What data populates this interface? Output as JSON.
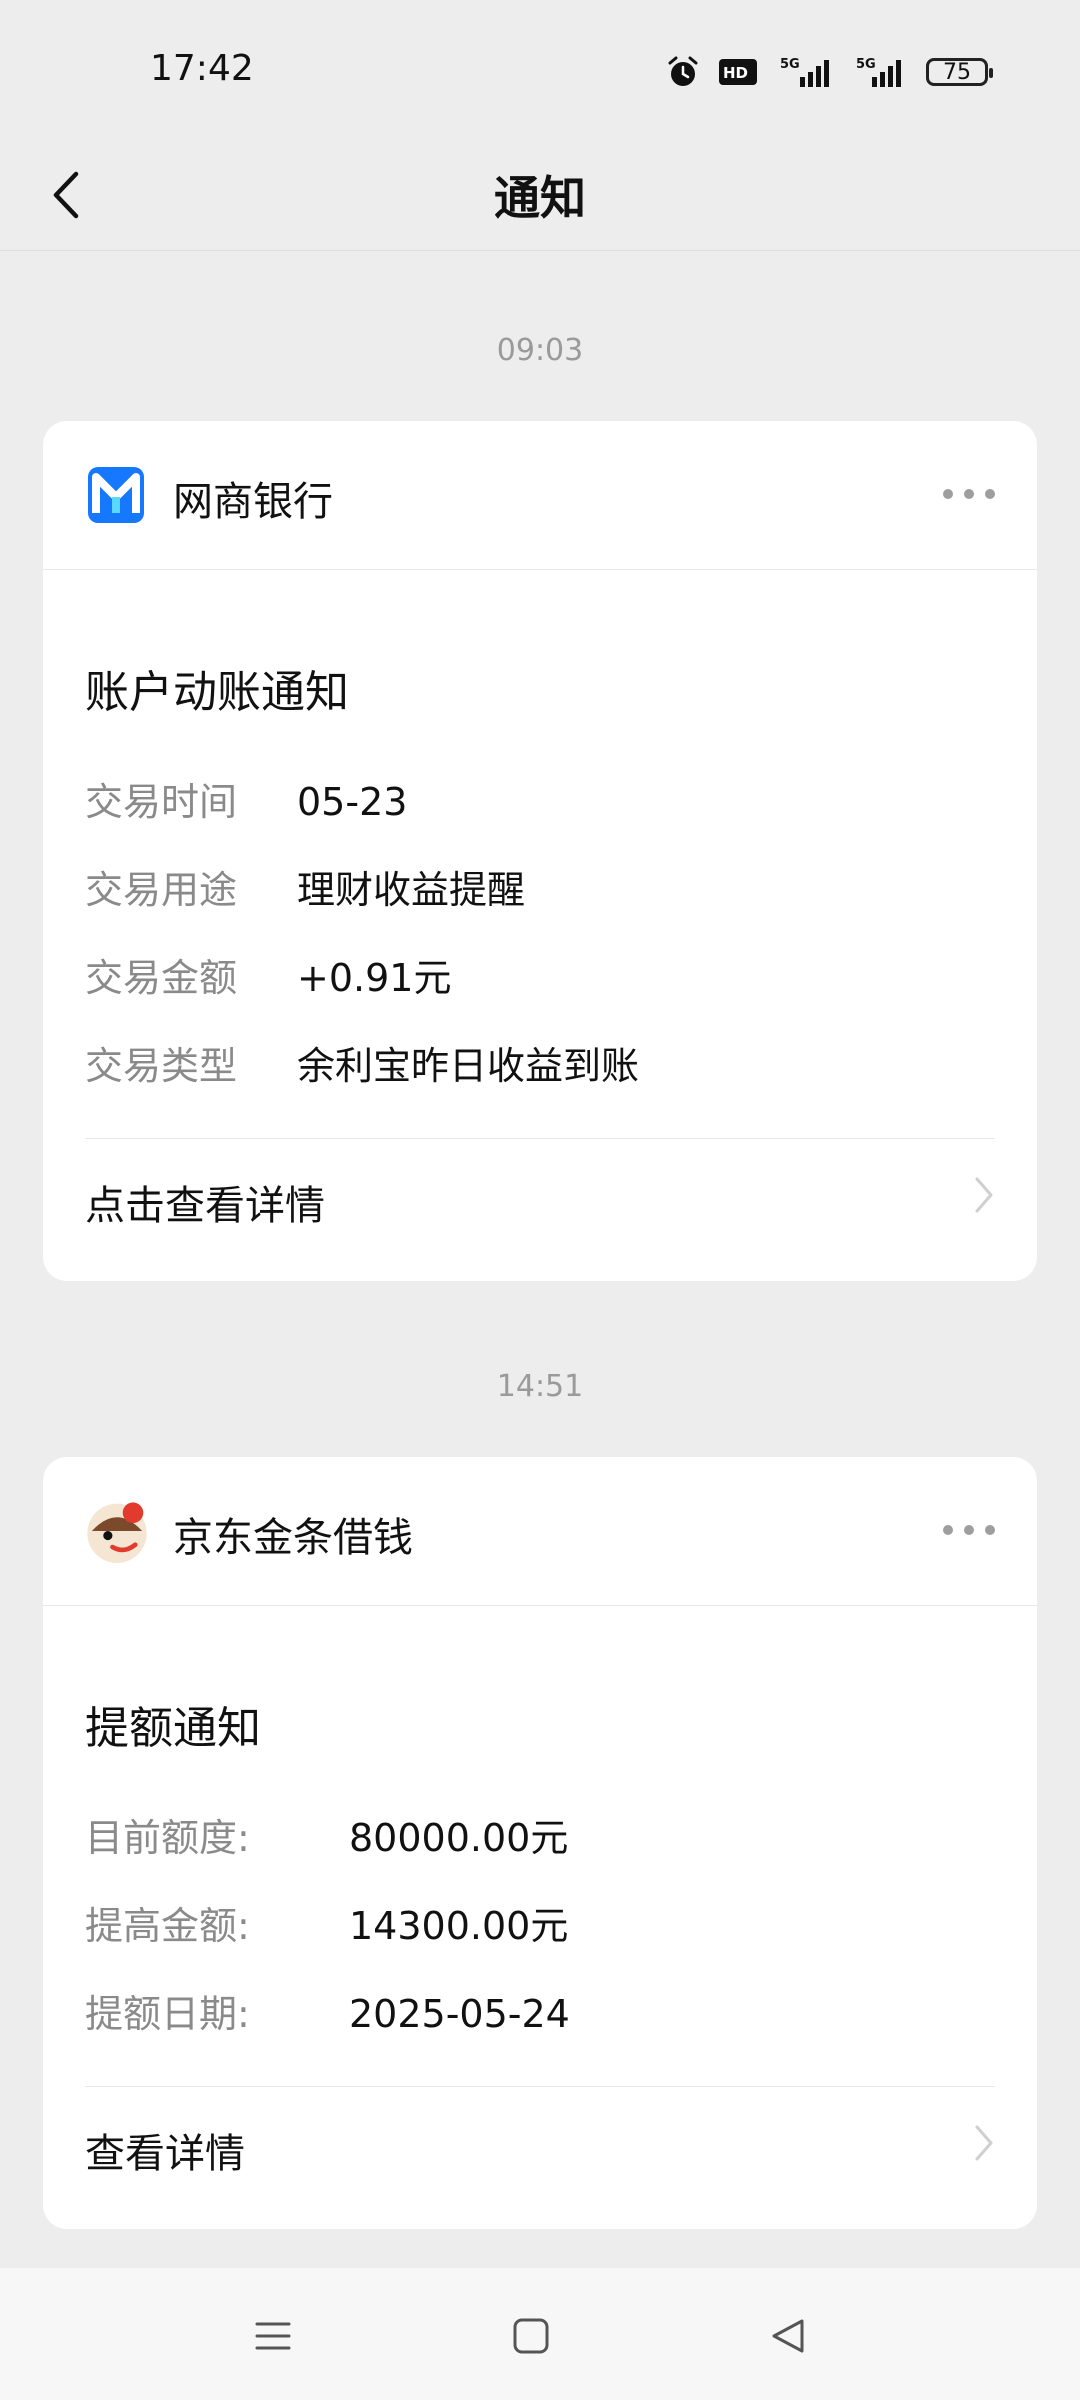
{
  "status_bar": {
    "time": "17:42",
    "battery": "75",
    "icons": [
      "alarm-icon",
      "hd-icon",
      "5g-signal-icon",
      "5g-signal-icon",
      "battery-icon"
    ]
  },
  "nav": {
    "title": "通知",
    "back_icon": "chevron-left-icon"
  },
  "notifications": [
    {
      "time": "09:03",
      "brand": "网商银行",
      "title": "账户动账通知",
      "rows": [
        {
          "label": "交易时间",
          "value": "05-23"
        },
        {
          "label": "交易用途",
          "value": "理财收益提醒"
        },
        {
          "label": "交易金额",
          "value": "+0.91元"
        },
        {
          "label": "交易类型",
          "value": "余利宝昨日收益到账"
        }
      ],
      "footer": "点击查看详情"
    },
    {
      "time": "14:51",
      "brand": "京东金条借钱",
      "title": "提额通知",
      "rows": [
        {
          "label": "目前额度:",
          "value": "80000.00元"
        },
        {
          "label": "提高金额:",
          "value": "14300.00元"
        },
        {
          "label": "提额日期:",
          "value": "2025-05-24"
        }
      ],
      "footer": "查看详情"
    }
  ],
  "colors": {
    "background": "#ededed",
    "card": "#ffffff",
    "label_gray": "#8a8a8a",
    "mybank_blue": "#1677ff"
  }
}
